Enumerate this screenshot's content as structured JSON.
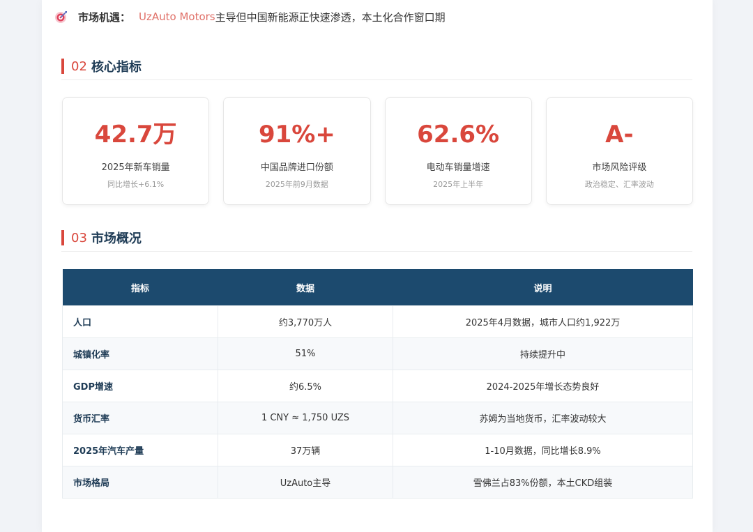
{
  "opportunity": {
    "label": "市场机遇：",
    "brand": "UzAuto Motors",
    "text": "主导但中国新能源正快速渗透，本土化合作窗口期"
  },
  "section02": {
    "num": "02",
    "title": "核心指标"
  },
  "metrics": [
    {
      "value": "42.7万",
      "label": "2025年新车销量",
      "sub": "同比增长+6.1%"
    },
    {
      "value": "91%+",
      "label": "中国品牌进口份额",
      "sub": "2025年前9月数据"
    },
    {
      "value": "62.6%",
      "label": "电动车销量增速",
      "sub": "2025年上半年"
    },
    {
      "value": "A-",
      "label": "市场风险评级",
      "sub": "政治稳定、汇率波动"
    }
  ],
  "section03": {
    "num": "03",
    "title": "市场概况"
  },
  "table": {
    "headers": [
      "指标",
      "数据",
      "说明"
    ],
    "rows": [
      [
        "人口",
        "约3,770万人",
        "2025年4月数据，城市人口约1,922万"
      ],
      [
        "城镇化率",
        "51%",
        "持续提升中"
      ],
      [
        "GDP增速",
        "约6.5%",
        "2024-2025年增长态势良好"
      ],
      [
        "货币汇率",
        "1 CNY ≈ 1,750 UZS",
        "苏姆为当地货币，汇率波动较大"
      ],
      [
        "2025年汽车产量",
        "37万辆",
        "1-10月数据，同比增长8.9%"
      ],
      [
        "市场格局",
        "UzAuto主导",
        "雪佛兰占83%份额，本土CKD组装"
      ]
    ]
  },
  "colors": {
    "accent": "#d9473c",
    "header": "#1c4a6e",
    "title": "#1f3c56"
  },
  "icons": {
    "opportunity": "target-icon"
  }
}
